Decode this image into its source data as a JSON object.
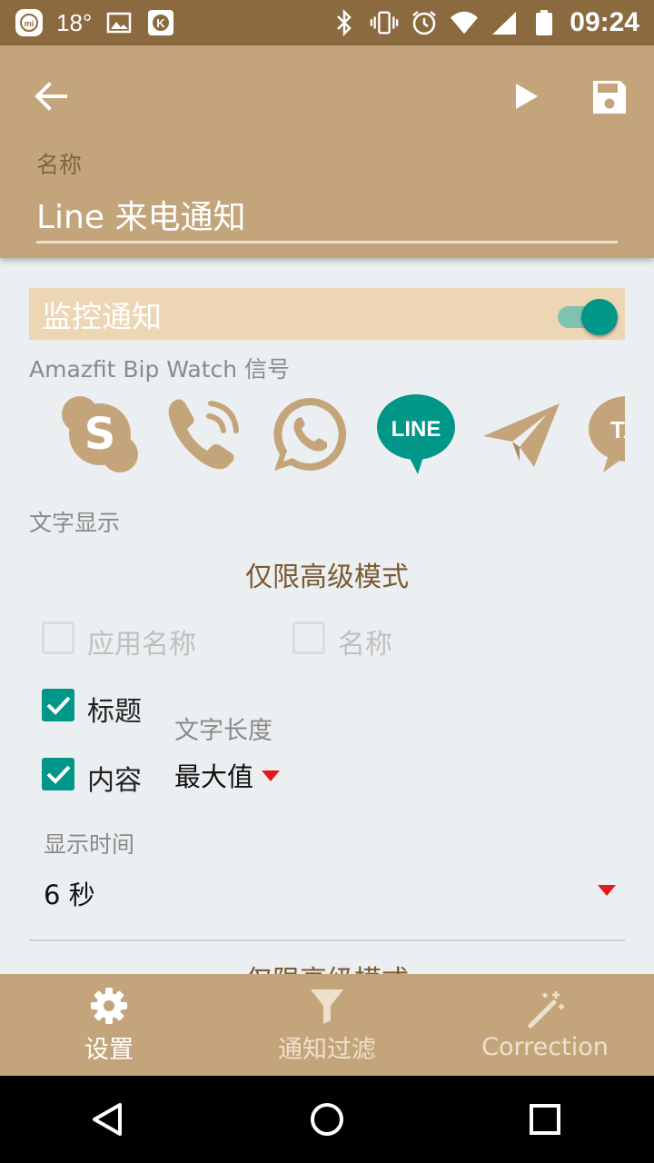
{
  "status_bar": {
    "temperature": "18°",
    "time": "09:24",
    "icons": [
      "mi-icon",
      "image-icon",
      "k-icon",
      "bluetooth-icon",
      "vibrate-icon",
      "alarm-icon",
      "wifi-icon",
      "signal-icon",
      "battery-icon"
    ]
  },
  "app_bar": {
    "name_label": "名称",
    "name_value": "Line 来电通知"
  },
  "monitor": {
    "title": "监控通知",
    "enabled": true,
    "accent": "#009688"
  },
  "signal": {
    "label": "Amazfit Bip Watch 信号",
    "icons": [
      "skype-icon",
      "phone-call-icon",
      "whatsapp-icon",
      "line-icon",
      "telegram-icon",
      "talk-icon"
    ],
    "selected": "line-icon"
  },
  "text_display": {
    "label": "文字显示",
    "advanced_only": "仅限高级模式",
    "app_name": "应用名称",
    "name": "名称",
    "title": "标题",
    "content": "内容",
    "text_length_label": "文字长度",
    "text_length_value": "最大值"
  },
  "display_time": {
    "label": "显示时间",
    "value": "6 秒"
  },
  "next_section": {
    "advanced_only": "仅限高级模式"
  },
  "bottom_nav": {
    "settings": "设置",
    "filter": "通知过滤",
    "correction": "Correction"
  },
  "colors": {
    "brand": "#c4a57b",
    "status_bar": "#8b6a3f",
    "highlight": "#ecd6b4",
    "arrow": "#e21a1a"
  }
}
